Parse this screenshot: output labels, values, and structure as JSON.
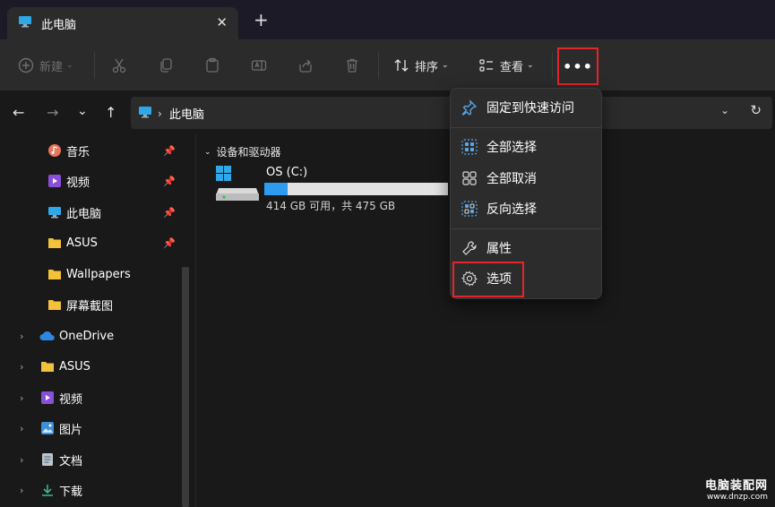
{
  "window": {
    "tab_title": "此电脑",
    "tab_close_glyph": "✕",
    "new_tab_glyph": "+"
  },
  "toolbar": {
    "new_label": "新建",
    "sort_label": "排序",
    "view_label": "查看",
    "more_glyph": "•••",
    "caret": "⌄"
  },
  "nav": {
    "back": "←",
    "forward": "→",
    "recent": "⌄",
    "up": "↑"
  },
  "address": {
    "chevron": "›",
    "location": "此电脑",
    "dropdown": "⌄",
    "refresh": "↻"
  },
  "sidebar": {
    "quick_access": [
      {
        "label": "音乐",
        "icon": "music-icon"
      },
      {
        "label": "视频",
        "icon": "video-icon"
      },
      {
        "label": "此电脑",
        "icon": "pc-icon"
      },
      {
        "label": "ASUS",
        "icon": "folder-icon"
      },
      {
        "label": "Wallpapers",
        "icon": "folder-icon"
      },
      {
        "label": "屏幕截图",
        "icon": "folder-icon"
      }
    ],
    "tree": [
      {
        "label": "OneDrive",
        "icon": "cloud-icon"
      },
      {
        "label": "ASUS",
        "icon": "folder-icon"
      },
      {
        "label": "视频",
        "icon": "video-icon"
      },
      {
        "label": "图片",
        "icon": "image-icon"
      },
      {
        "label": "文档",
        "icon": "document-icon"
      },
      {
        "label": "下载",
        "icon": "download-icon"
      }
    ],
    "pin_glyph": "📌",
    "expander_glyph": "›"
  },
  "content": {
    "group_title": "设备和驱动器",
    "group_chevron": "⌄",
    "drive": {
      "name": "OS (C:)",
      "usage_fraction": 0.128,
      "space_text": "414 GB 可用，共 475 GB"
    }
  },
  "menu": {
    "items": [
      {
        "label": "固定到快速访问",
        "icon": "pin-icon"
      },
      {
        "label": "全部选择",
        "icon": "select-all-icon"
      },
      {
        "label": "全部取消",
        "icon": "select-none-icon"
      },
      {
        "label": "反向选择",
        "icon": "invert-selection-icon"
      },
      {
        "label": "属性",
        "icon": "wrench-icon"
      },
      {
        "label": "选项",
        "icon": "gear-icon"
      }
    ]
  },
  "watermark": {
    "line1": "电脑装配网",
    "line2": "www.dnzp.com"
  },
  "colors": {
    "accent": "#2d9bf0",
    "highlight_border": "#e3262b",
    "folder": "#f3c13a"
  }
}
